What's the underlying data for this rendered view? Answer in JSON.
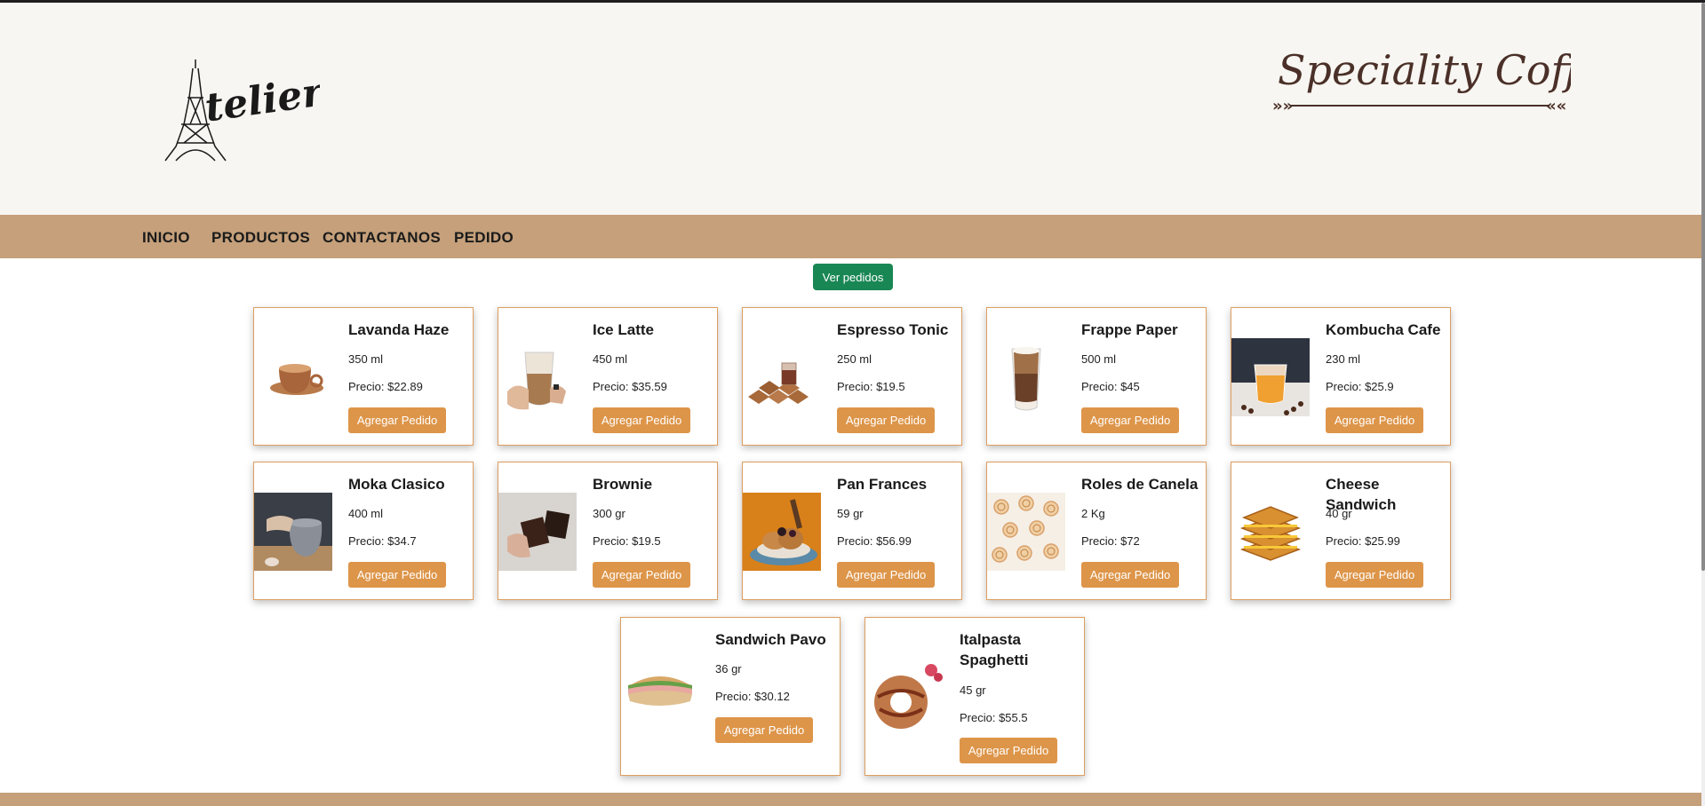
{
  "brand": {
    "name": "Atelier",
    "tagline": "Speciality Coffee"
  },
  "nav": [
    {
      "label": "INICIO"
    },
    {
      "label": "PRODUCTOS"
    },
    {
      "label": "CONTACTANOS"
    },
    {
      "label": "PEDIDO"
    }
  ],
  "view_orders_label": "Ver pedidos",
  "products": [
    {
      "name": "Lavanda Haze",
      "qty": "350 ml",
      "price": "Precio: $22.89",
      "button": "Agregar Pedido"
    },
    {
      "name": "Ice Latte",
      "qty": "450 ml",
      "price": "Precio: $35.59",
      "button": "Agregar Pedido"
    },
    {
      "name": "Espresso Tonic",
      "qty": "250 ml",
      "price": "Precio: $19.5",
      "button": "Agregar Pedido"
    },
    {
      "name": "Frappe Paper",
      "qty": "500 ml",
      "price": "Precio: $45",
      "button": "Agregar Pedido"
    },
    {
      "name": "Kombucha Cafe",
      "qty": "230 ml",
      "price": "Precio: $25.9",
      "button": "Agregar Pedido"
    },
    {
      "name": "Moka Clasico",
      "qty": "400 ml",
      "price": "Precio: $34.7",
      "button": "Agregar Pedido"
    },
    {
      "name": "Brownie",
      "qty": "300 gr",
      "price": "Precio: $19.5",
      "button": "Agregar Pedido"
    },
    {
      "name": "Pan Frances",
      "qty": "59 gr",
      "price": "Precio: $56.99",
      "button": "Agregar Pedido"
    },
    {
      "name": "Roles de Canela",
      "qty": "2 Kg",
      "price": "Precio: $72",
      "button": "Agregar Pedido"
    },
    {
      "name": "Cheese Sandwich",
      "qty": "40 gr",
      "price": "Precio: $25.99",
      "button": "Agregar Pedido"
    },
    {
      "name": "Sandwich Pavo",
      "qty": "36 gr",
      "price": "Precio: $30.12",
      "button": "Agregar Pedido"
    },
    {
      "name": "Italpasta Spaghetti",
      "qty": "45 gr",
      "price": "Precio: $55.5",
      "button": "Agregar Pedido"
    }
  ],
  "colors": {
    "header_bg": "#f8f6f2",
    "nav_bg": "#c5a07a",
    "card_border": "#dd9e5f",
    "add_button": "#dd9549",
    "view_orders_button": "#198754"
  }
}
